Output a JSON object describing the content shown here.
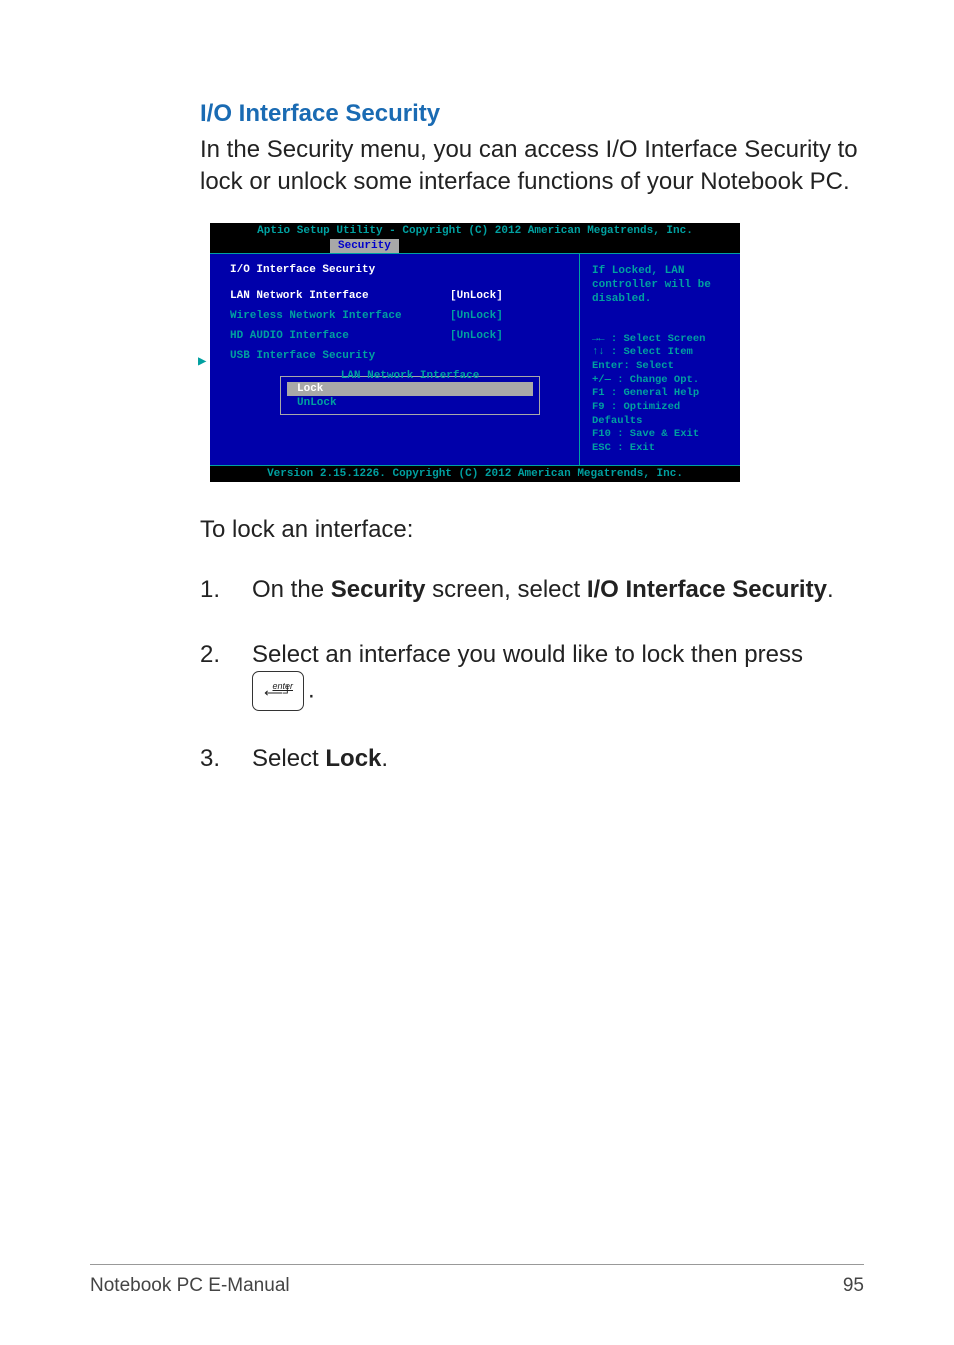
{
  "section_title": "I/O Interface Security",
  "intro": "In the Security menu, you can access I/O Interface Security to lock or unlock some interface functions of your Notebook PC.",
  "bios": {
    "title": "Aptio Setup Utility - Copyright (C) 2012 American Megatrends, Inc.",
    "tab": "Security",
    "heading": "I/O Interface Security",
    "items": [
      {
        "label": "LAN Network Interface",
        "value": "[UnLock]",
        "labelClass": "",
        "valueClass": "white"
      },
      {
        "label": "Wireless Network Interface",
        "value": "[UnLock]",
        "labelClass": "teal",
        "valueClass": ""
      },
      {
        "label": "HD AUDIO Interface",
        "value": "[UnLock]",
        "labelClass": "teal",
        "valueClass": ""
      }
    ],
    "submenu": "USB Interface Security",
    "popup_title": "LAN Network Interface",
    "popup_options": [
      "Lock",
      "UnLock"
    ],
    "help": "If Locked, LAN controller will be disabled.",
    "keys": {
      "l1": "→←  : Select Screen",
      "l2": "↑↓  : Select Item",
      "l3": "Enter: Select",
      "l4": "+/—  : Change Opt.",
      "l5": "F1   : General Help",
      "l6": "F9   : Optimized Defaults",
      "l7": "F10  : Save & Exit",
      "l8": "ESC  : Exit"
    },
    "footer": "Version 2.15.1226. Copyright (C) 2012 American Megatrends, Inc."
  },
  "instruct": "To lock an interface:",
  "steps": [
    {
      "n": "1.",
      "pre": "On the ",
      "b1": "Security",
      "mid": " screen, select ",
      "b2": "I/O Interface Security",
      "post": "."
    },
    {
      "n": "2.",
      "pre": "Select an interface you would like to lock then press ",
      "key": true,
      "post": "."
    },
    {
      "n": "3.",
      "pre": "Select ",
      "b1": "Lock",
      "post": "."
    }
  ],
  "key_label": "enter",
  "key_arrow": "↲",
  "footer_left": "Notebook PC E-Manual",
  "footer_right": "95"
}
